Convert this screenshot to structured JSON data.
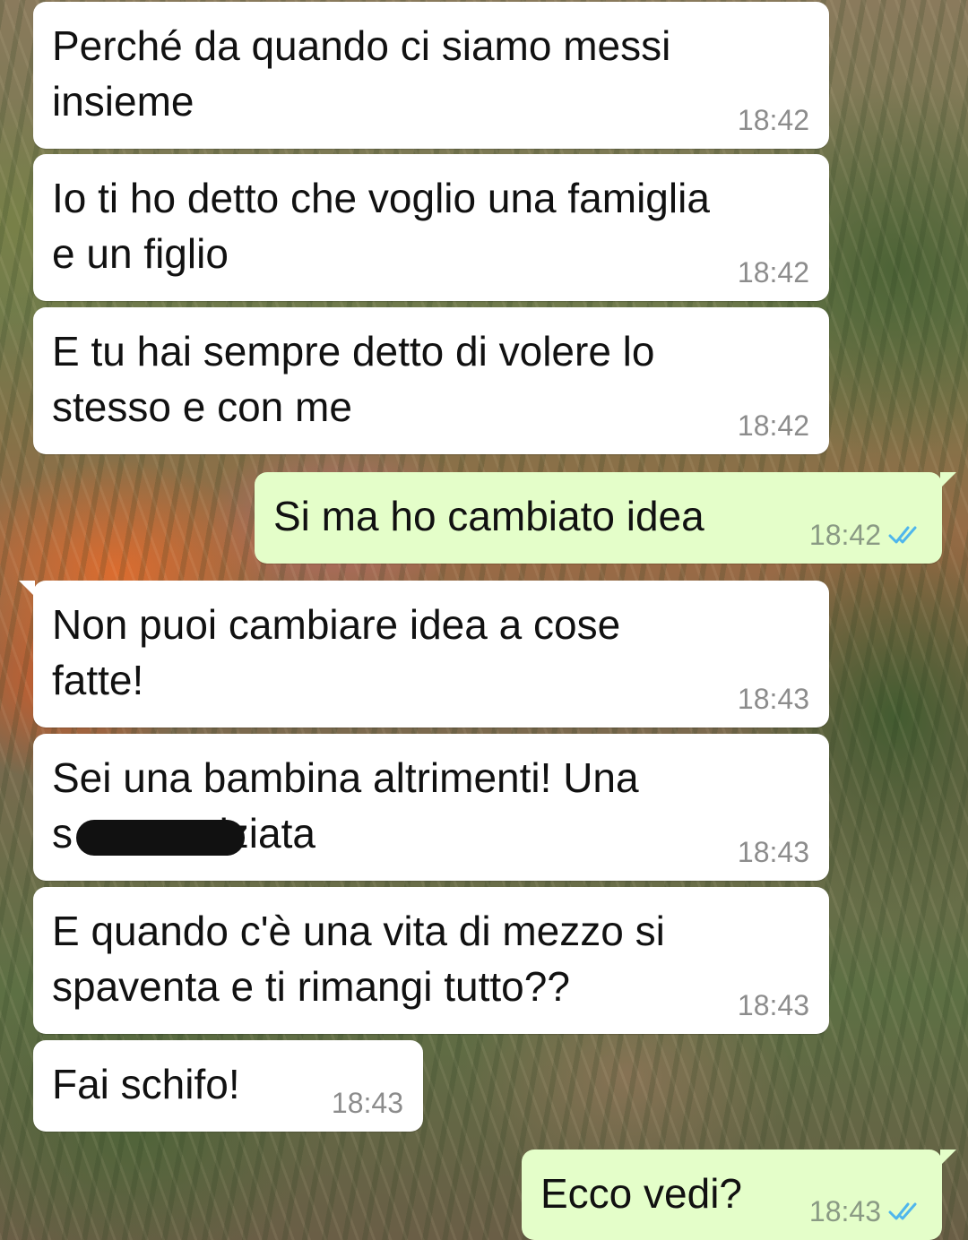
{
  "messages": [
    {
      "dir": "in",
      "text": "Perché da quando ci siamo messi\ninsieme",
      "time": "18:42"
    },
    {
      "dir": "in",
      "text": "Io ti ho detto che voglio una famiglia\ne un figlio",
      "time": "18:42"
    },
    {
      "dir": "in",
      "text": "E tu hai sempre detto di volere lo\nstesso e con me",
      "time": "18:42"
    },
    {
      "dir": "out",
      "text": "Si ma ho cambiato idea",
      "time": "18:42",
      "status": "read-double-check-icon"
    },
    {
      "dir": "in",
      "text": "Non puoi cambiare idea a cose\nfatte!",
      "time": "18:43"
    },
    {
      "dir": "in",
      "text": "Sei una bambina altrimenti! Una\ns           viziata",
      "time": "18:43",
      "redacted": true
    },
    {
      "dir": "in",
      "text": "E quando c'è una vita di mezzo si\nspaventa e ti rimangi tutto??",
      "time": "18:43"
    },
    {
      "dir": "in",
      "text": "Fai schifo!",
      "time": "18:43"
    },
    {
      "dir": "out",
      "text": "Ecco vedi?",
      "time": "18:43",
      "status": "read-double-check-icon"
    }
  ],
  "colors": {
    "incoming_bubble": "#ffffff",
    "outgoing_bubble": "#e4fec9",
    "read_check": "#4fb6ec",
    "timestamp": "#8c8c8c"
  }
}
